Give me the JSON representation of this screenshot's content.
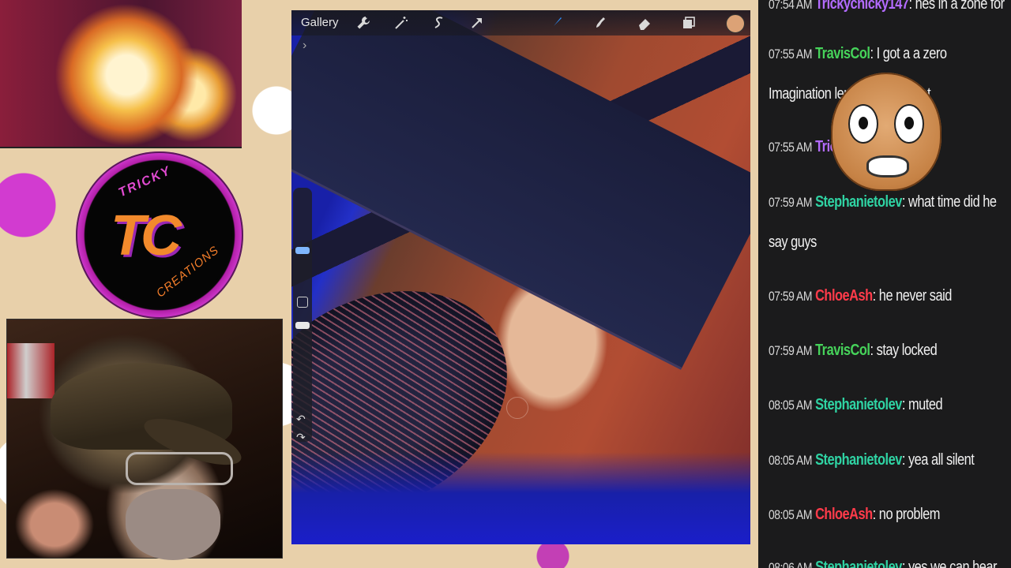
{
  "app": {
    "gallery_label": "Gallery",
    "tools": [
      {
        "name": "wrench-icon"
      },
      {
        "name": "magic-wand-icon"
      },
      {
        "name": "selection-icon"
      },
      {
        "name": "transform-arrow-icon"
      },
      {
        "name": "brush-icon"
      },
      {
        "name": "smudge-icon"
      },
      {
        "name": "eraser-icon"
      },
      {
        "name": "layers-icon"
      }
    ],
    "current_color": "#dca276",
    "accent_color": "#2b8fff"
  },
  "overlay": {
    "logo_top": "TRICKY",
    "logo_monogram": "TC",
    "logo_bottom": "CREATIONS"
  },
  "chat": {
    "messages": [
      {
        "time": "07:54 AM",
        "user": "Trickychicky147",
        "user_color": "#b36bff",
        "text": "hes in a zone for"
      },
      {
        "time": "07:55 AM",
        "user": "TravisCol",
        "user_color": "#46d35a",
        "text": "I got a a zero Imagination lemme keep quiet"
      },
      {
        "time": "07:55 AM",
        "user": "Tricky",
        "user_color": "#b36bff",
        "text": ""
      },
      {
        "time": "07:59 AM",
        "user": "Stephanietolev",
        "user_color": "#2fd3a3",
        "text": "what time did he say guys"
      },
      {
        "time": "07:59 AM",
        "user": "ChloeAsh",
        "user_color": "#ff3b4a",
        "text": "he never said"
      },
      {
        "time": "07:59 AM",
        "user": "TravisCol",
        "user_color": "#46d35a",
        "text": "stay locked"
      },
      {
        "time": "08:05 AM",
        "user": "Stephanietolev",
        "user_color": "#2fd3a3",
        "text": "muted"
      },
      {
        "time": "08:05 AM",
        "user": "Stephanietolev",
        "user_color": "#2fd3a3",
        "text": "yea all silent"
      },
      {
        "time": "08:05 AM",
        "user": "ChloeAsh",
        "user_color": "#ff3b4a",
        "text": "no problem"
      },
      {
        "time": "08:06 AM",
        "user": "Stephanietolev",
        "user_color": "#2fd3a3",
        "text": "yes we can hear"
      }
    ]
  }
}
